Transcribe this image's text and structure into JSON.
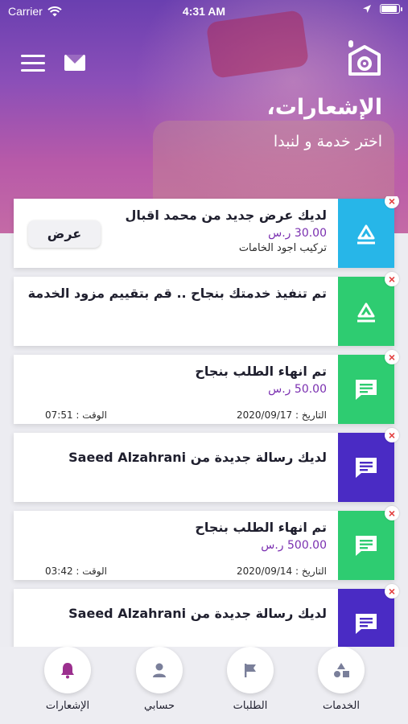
{
  "statusbar": {
    "carrier": "Carrier",
    "time": "4:31 AM"
  },
  "header": {
    "title": "الإشعارات،",
    "subtitle": "اختر خدمة و لنبدا"
  },
  "colors": {
    "blue": "#27b6e8",
    "green": "#2ecc71",
    "purple": "#4a2bc4",
    "price": "#7a2fb0",
    "close": "#e23d3d"
  },
  "notifications": [
    {
      "title": "لديك عرض جديد من محمد اقبال",
      "price": "30.00 ر.س",
      "note": "تركيب اجود الخامات",
      "button": "عرض",
      "icon": "tag-icon",
      "color": "blue"
    },
    {
      "title": "تم تنفيذ خدمتك بنجاح .. قم بتقييم مزود الخدمة",
      "icon": "tag-icon",
      "color": "green"
    },
    {
      "title": "تم انهاء الطلب بنجاح",
      "price": "50.00 ر.س",
      "date_label": "التاريخ : 2020/09/17",
      "time_label": "الوقت : 07:51",
      "icon": "message-icon",
      "color": "green"
    },
    {
      "title": "لديك رسالة جديدة من Saeed Alzahrani",
      "icon": "message-icon",
      "color": "purple"
    },
    {
      "title": "تم انهاء الطلب بنجاح",
      "price": "500.00 ر.س",
      "date_label": "التاريخ : 2020/09/14",
      "time_label": "الوقت : 03:42",
      "icon": "message-icon",
      "color": "green"
    },
    {
      "title": "لديك رسالة جديدة من Saeed Alzahrani",
      "icon": "message-icon",
      "color": "purple"
    }
  ],
  "tabs": [
    {
      "label": "الإشعارات",
      "icon": "bell-icon",
      "active": true
    },
    {
      "label": "حسابي",
      "icon": "user-icon"
    },
    {
      "label": "الطلبات",
      "icon": "flag-icon"
    },
    {
      "label": "الخدمات",
      "icon": "shapes-icon"
    }
  ]
}
